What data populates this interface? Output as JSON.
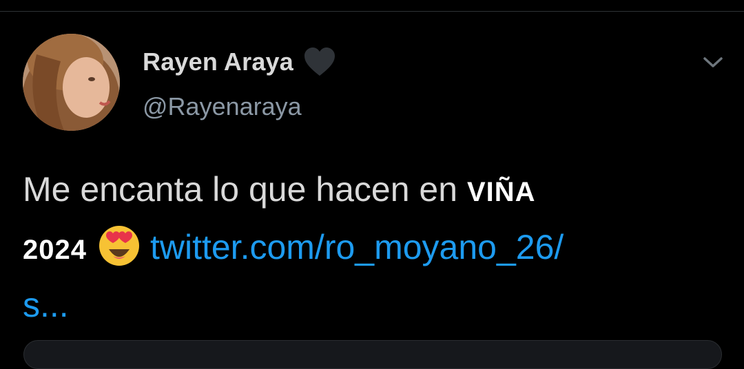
{
  "author": {
    "display_name": "Rayen Araya",
    "handle": "@Rayenaraya",
    "badge_icon": "heart-icon",
    "avatar_icon": "avatar-photo"
  },
  "tweet": {
    "text_line1": "Me encanta lo que hacen en",
    "overlay_word1": "VIÑA",
    "overlay_word2": "2024",
    "emoji": "heart-eyes-emoji",
    "link_part1": "twitter.com/ro_moyano_26/",
    "link_part2": "s..."
  },
  "menu": {
    "icon": "chevron-down-icon"
  },
  "colors": {
    "background": "#000000",
    "text": "#d9d9d9",
    "secondary_text": "#8b98a5",
    "link": "#1d9bf0"
  }
}
